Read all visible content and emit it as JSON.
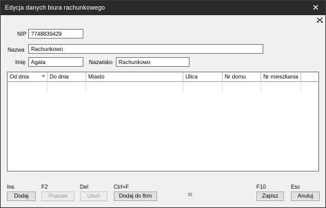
{
  "window": {
    "title": "Edycja danych biura rachunkowego",
    "close_glyph": "✕"
  },
  "form": {
    "nip_label": "NIP",
    "nip_value": "7748839429",
    "nazwa_label": "Nazwa",
    "nazwa_value": "Rachunkowo",
    "imie_label": "Imię",
    "imie_value": "Agata",
    "nazwisko_label": "Nazwisko",
    "nazwisko_value": "Rachunkowo"
  },
  "grid": {
    "columns": [
      "Od dnia",
      "Do dnia",
      "Miasto",
      "Ulica",
      "Nr domu",
      "Nr mieszkania"
    ],
    "sort_icon": "sort-down-icon"
  },
  "toolbar": {
    "add_shortcut": "Ins",
    "add_label": "Dodaj",
    "edit_shortcut": "F2",
    "edit_label": "Popraw",
    "delete_shortcut": "Del",
    "delete_label": "Usuń",
    "addfirm_shortcut": "Ctrl+F",
    "addfirm_label": "Dodaj do firm",
    "record_count": "[1]",
    "save_shortcut": "F10",
    "save_label": "Zapisz",
    "cancel_shortcut": "Esc",
    "cancel_label": "Anuluj"
  },
  "colors": {
    "titlebar": "#2b2b2b",
    "window_bg": "#f0f0f0",
    "button_bg": "#e1e1e1",
    "disabled_text": "#9a9a9a"
  }
}
